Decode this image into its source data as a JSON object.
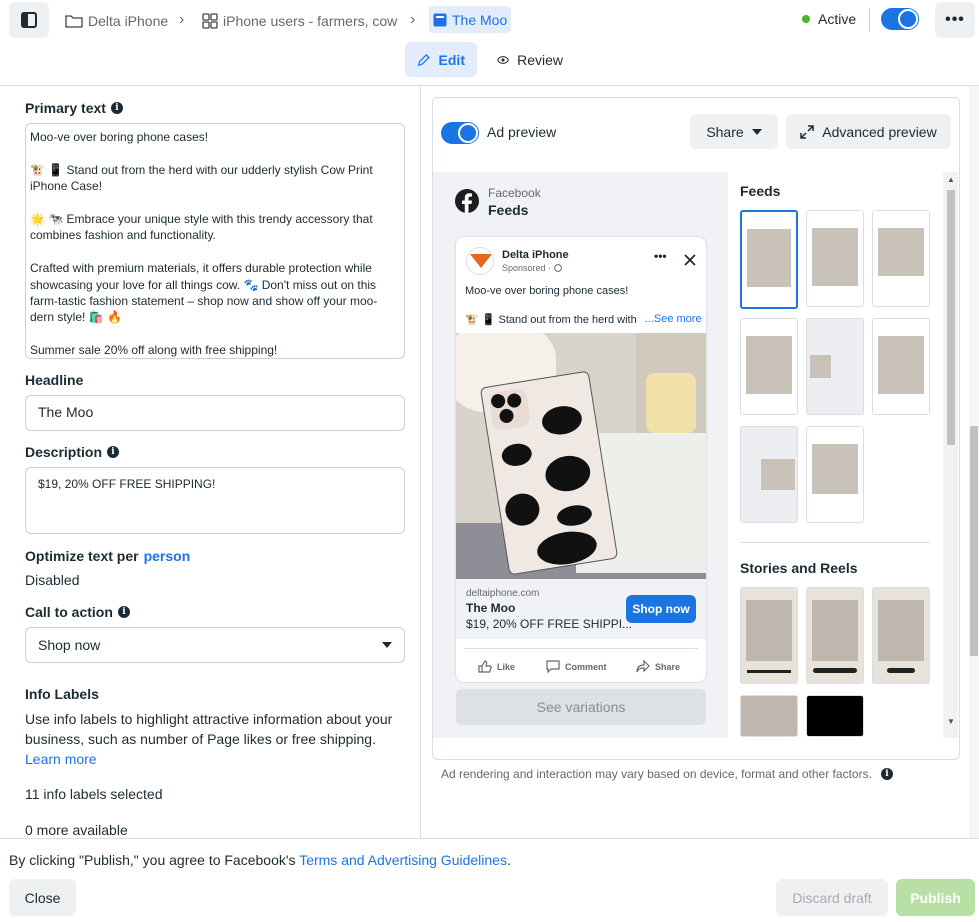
{
  "topbar": {
    "breadcrumbs": [
      {
        "label": "Delta iPhone",
        "icon": "folder-icon"
      },
      {
        "label": "iPhone users - farmers, cow",
        "icon": "grid-icon"
      },
      {
        "label": "The Moo",
        "icon": "ad-icon"
      }
    ],
    "status": "Active",
    "status_color": "#42b72a"
  },
  "mode_tabs": {
    "edit": "Edit",
    "review": "Review"
  },
  "form": {
    "primary_text_label": "Primary text",
    "primary_text": [
      "Moo-ve over boring phone cases!",
      "🐮 📱 Stand out from the herd with our udderly stylish Cow Print iPhone Case!",
      "🌟 🐄 Embrace your unique style with this trendy accessory that combines fashion and functionality.",
      "Crafted with premium materials, it offers durable protection while showcasing your love for all things cow. 🐾 Don't miss out on this farm-tastic fashion statement – shop now and show off your moo-dern style! 🛍️ 🔥",
      "Summer sale 20% off along with free shipping!"
    ],
    "headline_label": "Headline",
    "headline_value": "The Moo",
    "description_label": "Description",
    "description_value": "$19, 20% OFF FREE SHIPPING!",
    "optimize_label": "Optimize text per",
    "optimize_link": "person",
    "optimize_value": "Disabled",
    "cta_label": "Call to action",
    "cta_value": "Shop now",
    "info_labels_title": "Info Labels",
    "info_labels_desc": "Use info labels to highlight attractive information about your business, such as number of Page likes or free shipping.",
    "learn_more": "Learn more",
    "info_selected": "11 info labels selected",
    "more_available": "0 more available"
  },
  "preview": {
    "toggle_label": "Ad preview",
    "share_label": "Share",
    "advanced_label": "Advanced preview",
    "placement_platform": "Facebook",
    "placement_name": "Feeds",
    "page_name": "Delta iPhone",
    "sponsored": "Sponsored ·",
    "post_text_1": "Moo-ve over boring phone cases!",
    "post_text_2": "🐮 📱 Stand out from the herd with",
    "see_more": "...See more",
    "link_domain": "deltaiphone.com",
    "link_headline": "The Moo",
    "link_desc": "$19, 20% OFF FREE SHIPPI...",
    "shop_now": "Shop now",
    "like": "Like",
    "comment": "Comment",
    "share": "Share",
    "see_variations": "See variations",
    "feeds_heading": "Feeds",
    "stories_heading": "Stories and Reels",
    "disclaimer": "Ad rendering and interaction may vary based on device, format and other factors."
  },
  "footer": {
    "agree_prefix": "By clicking \"Publish,\" you agree to Facebook's",
    "terms_link": "Terms and Advertising Guidelines",
    "period": ".",
    "close": "Close",
    "discard": "Discard draft",
    "publish": "Publish"
  },
  "colors": {
    "accent": "#1b74e4",
    "publish_disabled": "#b8dfa4",
    "button_gray": "#eef0f2"
  }
}
